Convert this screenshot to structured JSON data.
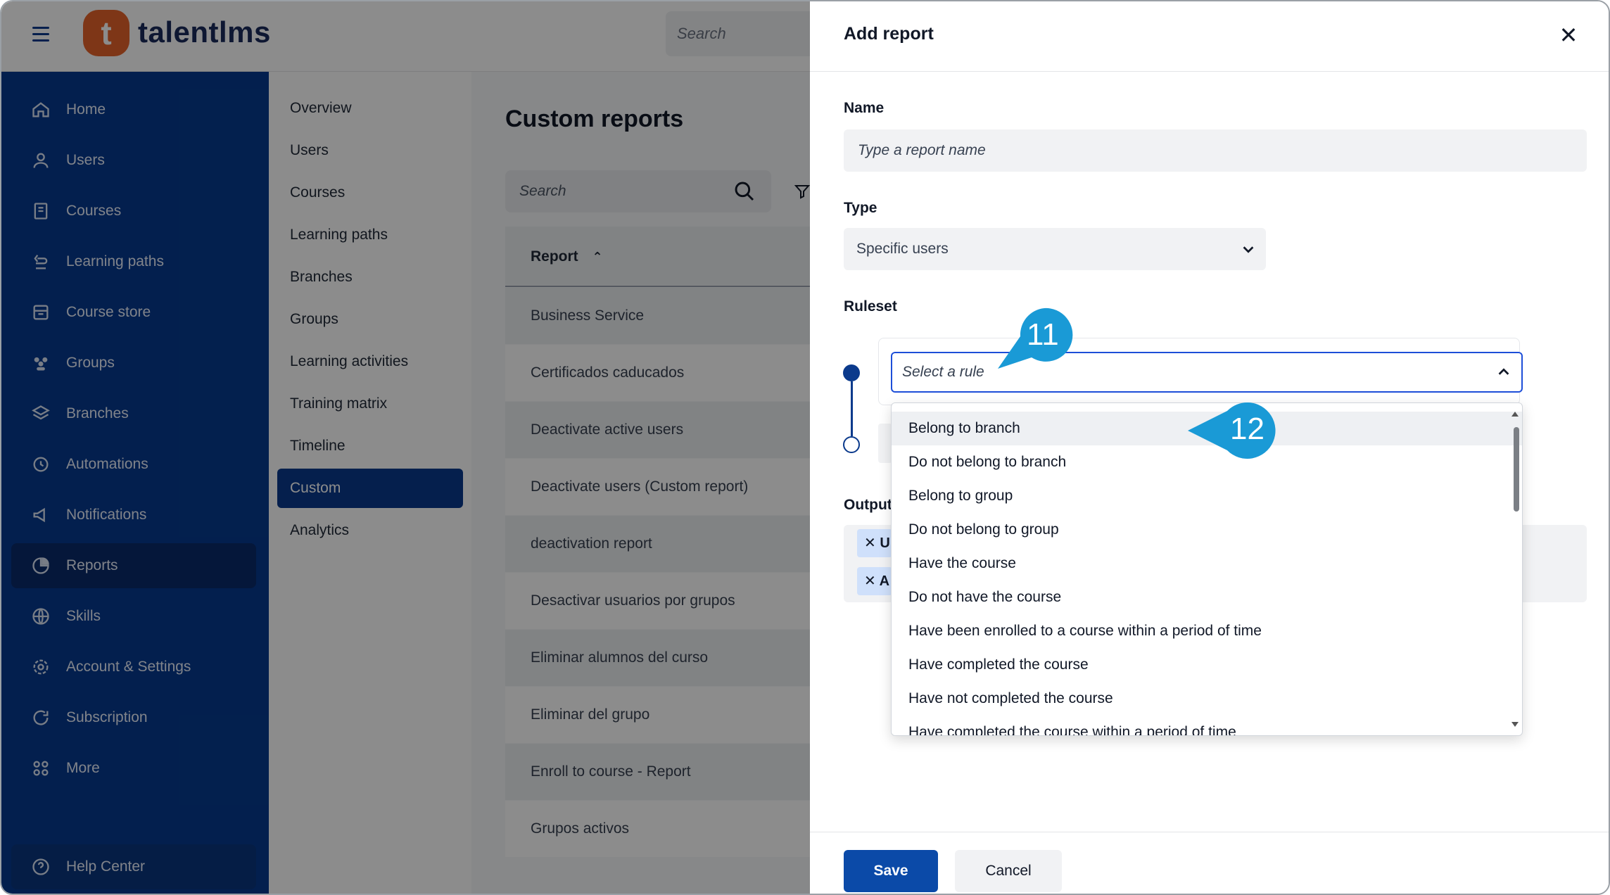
{
  "app": {
    "logo_letter": "t",
    "logo_text": "talentlms",
    "top_search_placeholder": "Search",
    "brand_color": "#063a8e",
    "accent_color": "#e5632b"
  },
  "sidebar": {
    "items": [
      {
        "label": "Home",
        "icon": "home-icon"
      },
      {
        "label": "Users",
        "icon": "user-icon"
      },
      {
        "label": "Courses",
        "icon": "book-icon"
      },
      {
        "label": "Learning paths",
        "icon": "path-icon"
      },
      {
        "label": "Course store",
        "icon": "store-icon"
      },
      {
        "label": "Groups",
        "icon": "groups-icon"
      },
      {
        "label": "Branches",
        "icon": "layers-icon"
      },
      {
        "label": "Automations",
        "icon": "automation-icon"
      },
      {
        "label": "Notifications",
        "icon": "megaphone-icon"
      },
      {
        "label": "Reports",
        "icon": "pie-chart-icon",
        "active": true
      },
      {
        "label": "Skills",
        "icon": "globe-icon"
      },
      {
        "label": "Account & Settings",
        "icon": "gear-icon"
      },
      {
        "label": "Subscription",
        "icon": "refresh-icon"
      },
      {
        "label": "More",
        "icon": "grid-icon"
      }
    ],
    "help_label": "Help Center"
  },
  "submenu": {
    "items": [
      "Overview",
      "Users",
      "Courses",
      "Learning paths",
      "Branches",
      "Groups",
      "Learning activities",
      "Training matrix",
      "Timeline",
      "Custom",
      "Analytics"
    ],
    "active": "Custom"
  },
  "main": {
    "title": "Custom reports",
    "search_placeholder": "Search",
    "column_header": "Report",
    "rows": [
      "Business Service",
      "Certificados caducados",
      "Deactivate active users",
      "Deactivate users (Custom report)",
      "deactivation report",
      "Desactivar usuarios por grupos",
      "Eliminar alumnos del curso",
      "Eliminar del grupo",
      "Enroll to course - Report",
      "Grupos activos"
    ]
  },
  "drawer": {
    "title": "Add report",
    "name_label": "Name",
    "name_placeholder": "Type a report name",
    "type_label": "Type",
    "type_value": "Specific users",
    "ruleset_label": "Ruleset",
    "rule_placeholder": "Select a rule",
    "output_label": "Output",
    "output_chips": [
      "U",
      "A"
    ],
    "rule_options": [
      "Belong to branch",
      "Do not belong to branch",
      "Belong to group",
      "Do not belong to group",
      "Have the course",
      "Do not have the course",
      "Have been enrolled to a course within a period of time",
      "Have completed the course",
      "Have not completed the course",
      "Have completed the course within a period of time"
    ],
    "save_label": "Save",
    "cancel_label": "Cancel"
  },
  "callouts": {
    "first": "11",
    "second": "12",
    "color": "#1a9ad6"
  }
}
